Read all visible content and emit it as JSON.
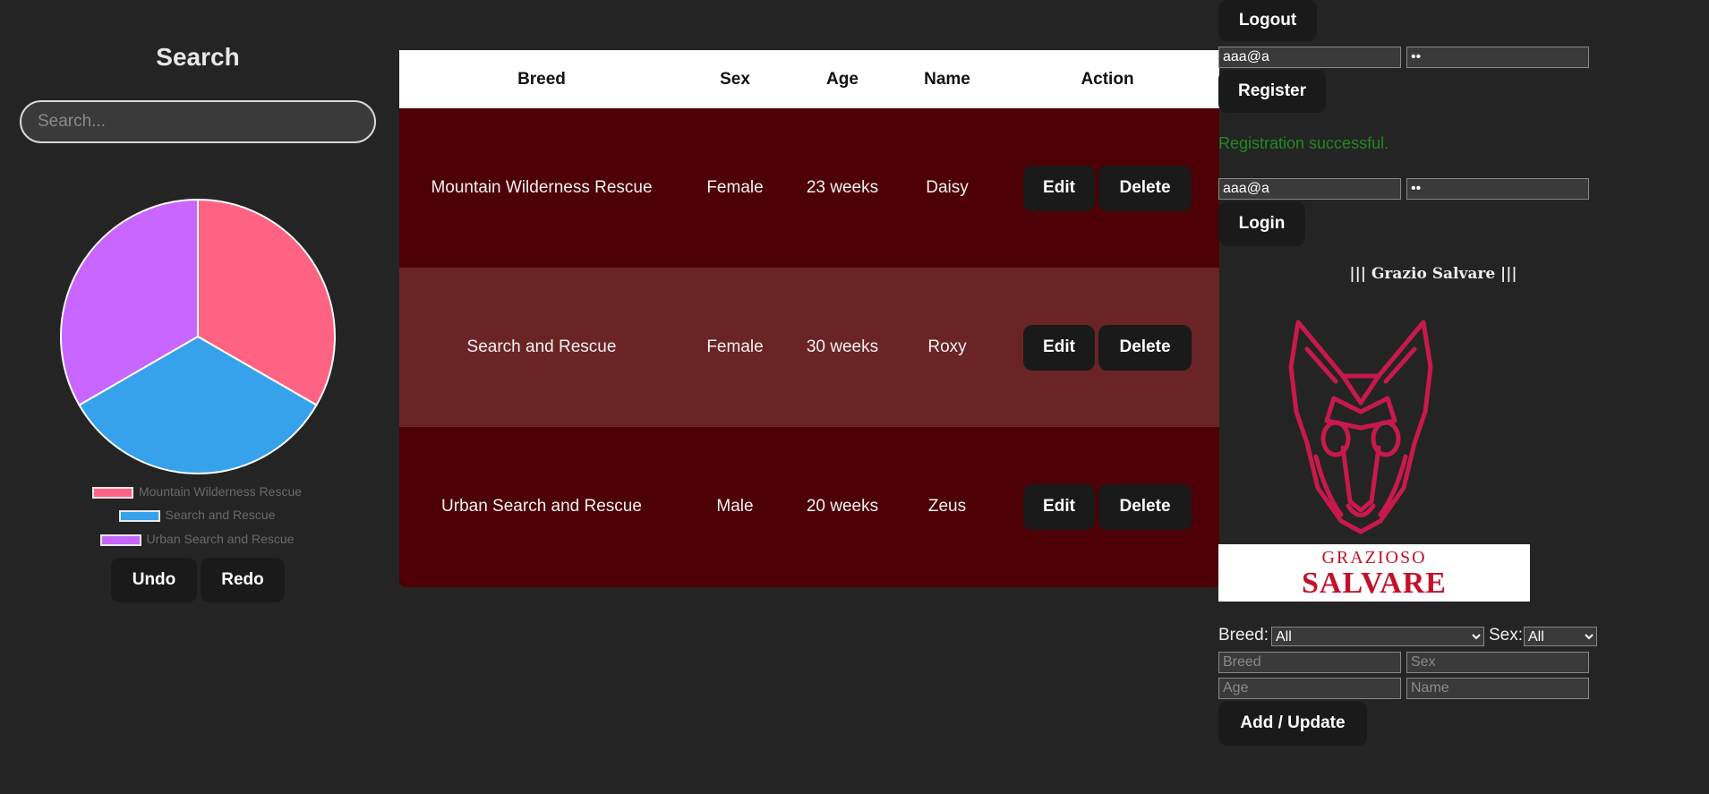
{
  "search": {
    "title": "Search",
    "placeholder": "Search..."
  },
  "chart_data": {
    "type": "pie",
    "labels": [
      "Mountain Wilderness Rescue",
      "Search and Rescue",
      "Urban Search and Rescue"
    ],
    "values": [
      1,
      1,
      1
    ],
    "colors": [
      "#ff6384",
      "#36a2eb",
      "#c866ff"
    ],
    "legend": "bottom"
  },
  "history": {
    "undo_label": "Undo",
    "redo_label": "Redo"
  },
  "table": {
    "headers": [
      "Breed",
      "Sex",
      "Age",
      "Name",
      "Action"
    ],
    "rows": [
      {
        "breed": "Mountain Wilderness Rescue",
        "sex": "Female",
        "age": "23 weeks",
        "name": "Daisy"
      },
      {
        "breed": "Search and Rescue",
        "sex": "Female",
        "age": "30 weeks",
        "name": "Roxy"
      },
      {
        "breed": "Urban Search and Rescue",
        "sex": "Male",
        "age": "20 weeks",
        "name": "Zeus"
      }
    ],
    "edit_label": "Edit",
    "delete_label": "Delete",
    "row_colors": [
      "#4d0005",
      "#6b2426"
    ]
  },
  "auth": {
    "logout_label": "Logout",
    "register": {
      "email_value": "aaa@a",
      "password_value": "••",
      "button_label": "Register"
    },
    "message": "Registration successful.",
    "message_color": "#1f8a1f",
    "login": {
      "email_value": "aaa@a",
      "password_value": "••",
      "button_label": "Login"
    }
  },
  "brand": {
    "title": "||| Grazio Salvare |||",
    "logo_line1": "GRAZIOSO",
    "logo_line2": "SALVARE",
    "logo_color": "#c4102a"
  },
  "filters": {
    "breed_label": "Breed:",
    "breed_selected": "All",
    "sex_label": "Sex:",
    "sex_selected": "All"
  },
  "editor": {
    "breed_placeholder": "Breed",
    "sex_placeholder": "Sex",
    "age_placeholder": "Age",
    "name_placeholder": "Name",
    "submit_label": "Add / Update"
  }
}
